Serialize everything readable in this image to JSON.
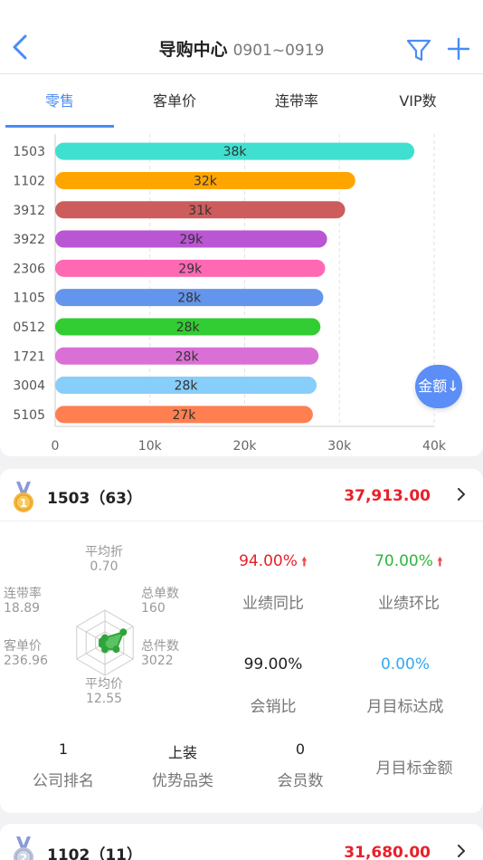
{
  "header": {
    "title": "导购中心",
    "date_range": "0901~0919"
  },
  "tabs": [
    {
      "label": "零售",
      "active": true
    },
    {
      "label": "客单价",
      "active": false
    },
    {
      "label": "连带率",
      "active": false
    },
    {
      "label": "VIP数",
      "active": false
    }
  ],
  "chart_data": {
    "type": "bar",
    "orientation": "horizontal",
    "categories": [
      "1503",
      "1102",
      "3912",
      "3922",
      "2306",
      "1105",
      "0512",
      "1721",
      "3004",
      "5105"
    ],
    "values": [
      37913,
      31680,
      30600,
      28700,
      28500,
      28300,
      28000,
      27800,
      27600,
      27200
    ],
    "data_labels": [
      "38k",
      "32k",
      "31k",
      "29k",
      "29k",
      "28k",
      "28k",
      "28k",
      "28k",
      "27k"
    ],
    "colors": [
      "#40e0d0",
      "#ffa500",
      "#cd5c5c",
      "#ba55d3",
      "#ff69b4",
      "#6495ed",
      "#32cd32",
      "#da70d6",
      "#87cefa",
      "#ff7f50"
    ],
    "xlim": [
      0,
      40000
    ],
    "xticks": [
      0,
      10000,
      20000,
      30000,
      40000
    ],
    "xtick_labels": [
      "0",
      "10k",
      "20k",
      "30k",
      "40k"
    ],
    "grid": true
  },
  "sort_button": {
    "label": "金额↓"
  },
  "card1": {
    "store": "1503（63）",
    "amount": "37,913.00",
    "radar": {
      "labels": [
        {
          "name": "平均折",
          "value": "0.70"
        },
        {
          "name": "总单数",
          "value": "160"
        },
        {
          "name": "总件数",
          "value": "3022"
        },
        {
          "name": "平均价",
          "value": "12.55"
        },
        {
          "name": "客单价",
          "value": "236.96"
        },
        {
          "name": "连带率",
          "value": "18.89"
        }
      ],
      "levels": [
        0.15,
        0.65,
        0.4,
        0.2,
        0.1,
        0.1
      ]
    },
    "metrics": [
      {
        "value": "94.00%",
        "label": "业绩同比",
        "color": "#e8202a",
        "arrow": "🠙"
      },
      {
        "value": "70.00%",
        "label": "业绩环比",
        "color": "#2fb53d",
        "arrow": "🠙"
      },
      {
        "value": "99.00%",
        "label": "会销比",
        "color": "#222222",
        "arrow": ""
      },
      {
        "value": "0.00%",
        "label": "月目标达成",
        "color": "#33aaee",
        "arrow": ""
      }
    ],
    "bottom": [
      {
        "value": "1",
        "label": "公司排名"
      },
      {
        "value": "上装",
        "label": "优势品类"
      },
      {
        "value": "0",
        "label": "会员数"
      },
      {
        "value": "",
        "label": "月目标金额"
      }
    ],
    "medal_rank": "1"
  },
  "card2": {
    "store": "1102（11）",
    "amount": "31,680.00",
    "medal_rank": "2"
  }
}
